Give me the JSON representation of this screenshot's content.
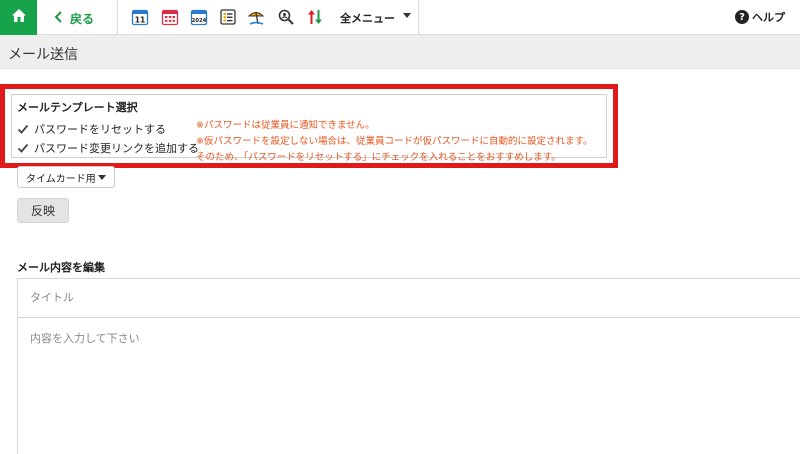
{
  "toolbar": {
    "back_label": "戻る",
    "calendar_day": "11",
    "calendar_year": "2024",
    "menu_label": "全メニュー",
    "help_label": "ヘルプ",
    "help_symbol": "?",
    "accent_color": "#17a34a"
  },
  "page": {
    "title": "メール送信"
  },
  "template": {
    "heading": "メールテンプレート選択",
    "options": [
      {
        "label": "パスワードをリセットする",
        "checked": true
      },
      {
        "label": "パスワード変更リンクを追加する",
        "checked": true
      }
    ],
    "notes": [
      "※パスワードは従業員に通知できません。",
      "※仮パスワードを設定しない場合は、従業員コードが仮パスワードに自動的に設定されます。",
      "そのため、「パスワードをリセットする」にチェックを入れることをおすすめします。"
    ],
    "note_color": "#e8551e",
    "highlight_color": "#e0191b",
    "selected_template": "タイムカード用",
    "apply_label": "反映"
  },
  "edit": {
    "heading": "メール内容を編集",
    "subject_placeholder": "タイトル",
    "body_placeholder": "内容を入力して下さい"
  }
}
